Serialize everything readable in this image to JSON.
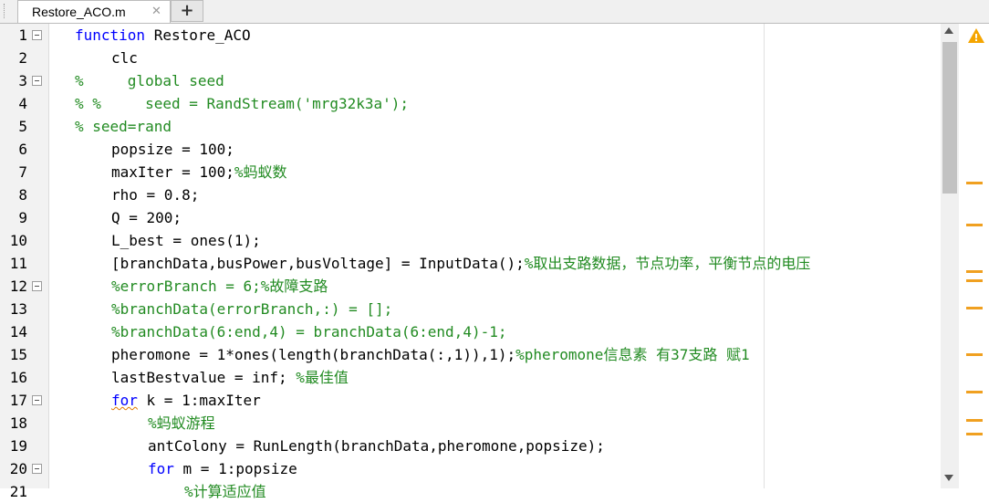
{
  "tab": {
    "filename": "Restore_ACO.m",
    "close_glyph": "✕",
    "add_glyph": "+"
  },
  "lines": [
    {
      "n": "1",
      "fold": true,
      "indent": 0,
      "parts": [
        {
          "c": "kw",
          "t": "function"
        },
        {
          "c": "",
          "t": " Restore_ACO"
        }
      ]
    },
    {
      "n": "2",
      "fold": false,
      "indent": 4,
      "parts": [
        {
          "c": "",
          "t": "clc"
        }
      ]
    },
    {
      "n": "3",
      "fold": true,
      "indent": 0,
      "parts": [
        {
          "c": "cm",
          "t": "%     global seed"
        }
      ]
    },
    {
      "n": "4",
      "fold": false,
      "indent": 0,
      "parts": [
        {
          "c": "cm",
          "t": "% %     seed = RandStream('mrg32k3a');"
        }
      ]
    },
    {
      "n": "5",
      "fold": false,
      "indent": 0,
      "parts": [
        {
          "c": "cm",
          "t": "% seed=rand"
        }
      ]
    },
    {
      "n": "6",
      "fold": false,
      "indent": 4,
      "parts": [
        {
          "c": "",
          "t": "popsize = 100;"
        }
      ]
    },
    {
      "n": "7",
      "fold": false,
      "indent": 4,
      "parts": [
        {
          "c": "",
          "t": "maxIter = 100;"
        },
        {
          "c": "cm",
          "t": "%蚂蚁数"
        }
      ]
    },
    {
      "n": "8",
      "fold": false,
      "indent": 4,
      "parts": [
        {
          "c": "",
          "t": "rho = 0.8;"
        }
      ]
    },
    {
      "n": "9",
      "fold": false,
      "indent": 4,
      "parts": [
        {
          "c": "",
          "t": "Q = 200;"
        }
      ]
    },
    {
      "n": "10",
      "fold": false,
      "indent": 4,
      "parts": [
        {
          "c": "",
          "t": "L_best = ones(1);"
        }
      ]
    },
    {
      "n": "11",
      "fold": false,
      "indent": 4,
      "parts": [
        {
          "c": "",
          "t": "[branchData,busPower,busVoltage] = InputData();"
        },
        {
          "c": "cm",
          "t": "%取出支路数据，节点功率，平衡节点的电压"
        }
      ]
    },
    {
      "n": "12",
      "fold": true,
      "indent": 4,
      "parts": [
        {
          "c": "cm",
          "t": "%errorBranch = 6;%故障支路"
        }
      ]
    },
    {
      "n": "13",
      "fold": false,
      "indent": 4,
      "parts": [
        {
          "c": "cm",
          "t": "%branchData(errorBranch,:) = [];"
        }
      ]
    },
    {
      "n": "14",
      "fold": false,
      "indent": 4,
      "parts": [
        {
          "c": "cm",
          "t": "%branchData(6:end,4) = branchData(6:end,4)-1;"
        }
      ]
    },
    {
      "n": "15",
      "fold": false,
      "indent": 4,
      "parts": [
        {
          "c": "",
          "t": "pheromone = 1*ones(length(branchData(:,1)),1);"
        },
        {
          "c": "cm",
          "t": "%pheromone信息素 有37支路 赋1"
        }
      ]
    },
    {
      "n": "16",
      "fold": false,
      "indent": 4,
      "parts": [
        {
          "c": "",
          "t": "lastBestvalue = inf; "
        },
        {
          "c": "cm",
          "t": "%最佳值"
        }
      ]
    },
    {
      "n": "17",
      "fold": true,
      "indent": 4,
      "parts": [
        {
          "c": "kw-squig",
          "t": "for"
        },
        {
          "c": "",
          "t": " k = 1:maxIter"
        }
      ]
    },
    {
      "n": "18",
      "fold": false,
      "indent": 8,
      "parts": [
        {
          "c": "cm",
          "t": "%蚂蚁游程"
        }
      ]
    },
    {
      "n": "19",
      "fold": false,
      "indent": 8,
      "parts": [
        {
          "c": "",
          "t": "antColony = RunLength(branchData,pheromone,popsize);"
        }
      ]
    },
    {
      "n": "20",
      "fold": true,
      "indent": 8,
      "parts": [
        {
          "c": "kw",
          "t": "for"
        },
        {
          "c": "",
          "t": " m = 1:popsize"
        }
      ]
    },
    {
      "n": "21",
      "fold": false,
      "indent": 12,
      "parts": [
        {
          "c": "cm",
          "t": "%计算适应值"
        }
      ]
    }
  ],
  "warning": {
    "icon": "warning-icon",
    "mark": "!",
    "color": "#f5a500"
  },
  "warning_markers": [
    0.34,
    0.43,
    0.53,
    0.55,
    0.61,
    0.71,
    0.79,
    0.85,
    0.88
  ]
}
